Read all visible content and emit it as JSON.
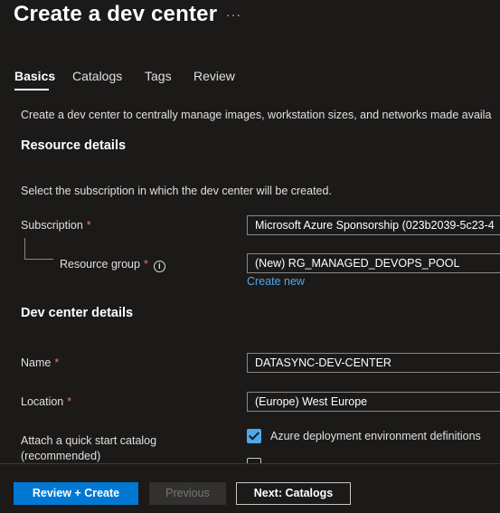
{
  "page": {
    "title": "Create a dev center",
    "more_label": "···"
  },
  "tabs": [
    {
      "label": "Basics",
      "active": true
    },
    {
      "label": "Catalogs",
      "active": false
    },
    {
      "label": "Tags",
      "active": false
    },
    {
      "label": "Review",
      "active": false
    }
  ],
  "description": "Create a dev center to centrally manage images, workstation sizes, and networks made availa",
  "resource_details": {
    "heading": "Resource details",
    "intro": "Select the subscription in which the dev center will be created.",
    "subscription": {
      "label": "Subscription",
      "required_mark": "*",
      "value": "Microsoft Azure Sponsorship (023b2039-5c23-4"
    },
    "resource_group": {
      "label": "Resource group",
      "required_mark": "*",
      "info_glyph": "i",
      "value": "(New) RG_MANAGED_DEVOPS_POOL",
      "create_new_label": "Create new"
    }
  },
  "dev_center_details": {
    "heading": "Dev center details",
    "name": {
      "label": "Name",
      "required_mark": "*",
      "value": "DATASYNC-DEV-CENTER"
    },
    "location": {
      "label": "Location",
      "required_mark": "*",
      "value": "(Europe) West Europe"
    },
    "quick_start": {
      "label_line1": "Attach a quick start catalog",
      "label_line2": "(recommended)",
      "option1_label": "Azure deployment environment definitions",
      "option1_checked": true,
      "option2_checked": false
    }
  },
  "footer": {
    "primary_label": "Review + Create",
    "previous_label": "Previous",
    "next_label": "Next: Catalogs"
  },
  "colors": {
    "background": "#1b1a19",
    "accent": "#0078d4",
    "link": "#4fa8ea",
    "required": "#f1707b"
  }
}
